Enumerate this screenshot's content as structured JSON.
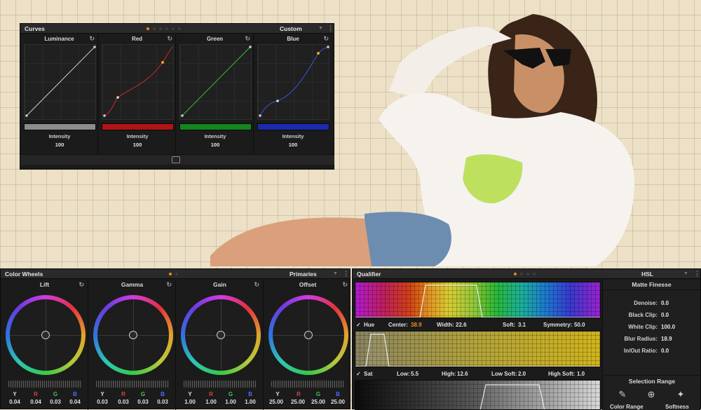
{
  "curves": {
    "title": "Curves",
    "mode": "Custom",
    "columns": [
      {
        "name": "Luminance",
        "intensity_label": "Intensity",
        "intensity": "100",
        "color": "#dcdcdc",
        "bar": "#8c8c8c"
      },
      {
        "name": "Red",
        "intensity_label": "Intensity",
        "intensity": "100",
        "color": "#d23030",
        "bar": "#b01515"
      },
      {
        "name": "Green",
        "intensity_label": "Intensity",
        "intensity": "100",
        "color": "#2fbf3a",
        "bar": "#15861d"
      },
      {
        "name": "Blue",
        "intensity_label": "Intensity",
        "intensity": "100",
        "color": "#3a52e0",
        "bar": "#1b2bb0"
      }
    ]
  },
  "wheels": {
    "title": "Color Wheels",
    "mode": "Primaries",
    "items": [
      {
        "name": "Lift",
        "Y": "0.04",
        "R": "0.04",
        "G": "0.03",
        "B": "0.04"
      },
      {
        "name": "Gamma",
        "Y": "0.03",
        "R": "0.03",
        "G": "0.03",
        "B": "0.03"
      },
      {
        "name": "Gain",
        "Y": "1.00",
        "R": "1.00",
        "G": "1.00",
        "B": "1.00"
      },
      {
        "name": "Offset",
        "Y": "25.00",
        "R": "25.00",
        "G": "25.00",
        "B": "25.00"
      }
    ],
    "channels": {
      "Y": "Y",
      "R": "R",
      "G": "G",
      "B": "B"
    },
    "channel_colors": {
      "Y": "#e0e0e0",
      "R": "#e04040",
      "G": "#3cc84a",
      "B": "#4a6cff"
    }
  },
  "qualifier": {
    "title": "Qualifier",
    "mode": "HSL",
    "hue": {
      "label": "Hue",
      "center_label": "Center:",
      "center": "38.9",
      "width_label": "Width:",
      "width": "22.6",
      "soft_label": "Soft:",
      "soft": "3.1",
      "sym_label": "Symmetry:",
      "sym": "50.0"
    },
    "sat": {
      "label": "Sat",
      "low_label": "Low:",
      "low": "5.5",
      "high_label": "High:",
      "high": "12.6",
      "lowsoft_label": "Low Soft:",
      "lowsoft": "2.0",
      "highsoft_label": "High Soft:",
      "highsoft": "1.0"
    },
    "matte": {
      "title": "Matte Finesse",
      "rows": [
        {
          "k": "Denoise:",
          "v": "0.0"
        },
        {
          "k": "Black Clip:",
          "v": "0.0"
        },
        {
          "k": "White Clip:",
          "v": "100.0"
        },
        {
          "k": "Blur Radius:",
          "v": "18.9"
        },
        {
          "k": "In/Out Ratio:",
          "v": "0.0"
        }
      ],
      "selection_title": "Selection Range",
      "color_range": "Color Range",
      "softness": "Softness"
    }
  },
  "icons": {
    "reset": "reset-icon",
    "picker": "eyedropper-icon",
    "more": "kebab-menu-icon"
  }
}
